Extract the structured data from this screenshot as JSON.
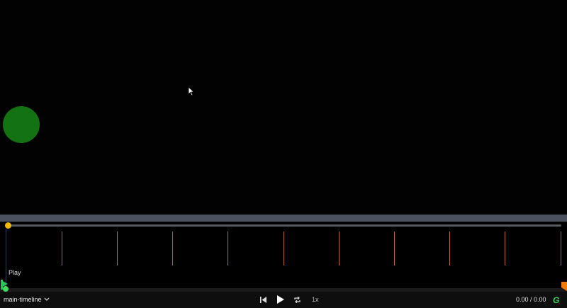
{
  "timeline": {
    "name": "main-timeline",
    "label": "Play",
    "time_display": "0.00 / 0.00",
    "speed": "1x",
    "progress": 0
  },
  "colors": {
    "stage_bg": "#020202",
    "circle": "#137313",
    "thumb": "#f5b800",
    "marker": "#b86a1c",
    "logo": "#39d353"
  },
  "icons": {
    "skip_back": "skip-back-icon",
    "play": "play-icon",
    "loop": "loop-icon",
    "dropdown": "chevron-down-icon",
    "logo": "gsap-logo-icon"
  },
  "logo_text": "G"
}
